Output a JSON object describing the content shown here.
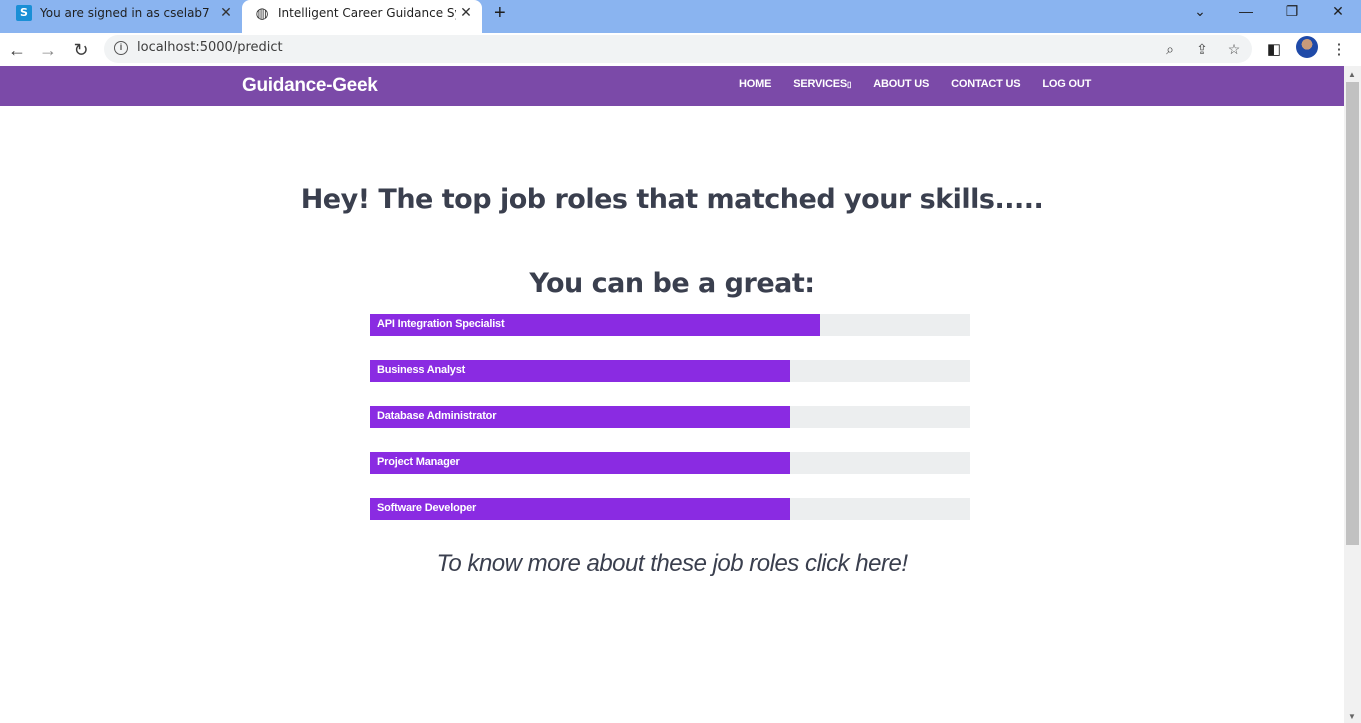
{
  "browser": {
    "tabs": [
      {
        "title": "You are signed in as cselab7",
        "icon": "s-logo-icon"
      },
      {
        "title": "Intelligent Career Guidance Syste",
        "icon": "globe-icon"
      }
    ],
    "url": "localhost:5000/predict"
  },
  "site": {
    "brand": "Guidance-Geek",
    "nav": [
      "HOME",
      "SERVICES",
      "ABOUT US",
      "CONTACT US",
      "LOG OUT"
    ],
    "services_caret": "▯"
  },
  "main": {
    "heading": "Hey! The top job roles that matched your skills.....",
    "subheading": "You can be a great:",
    "roles": [
      {
        "label": "API Integration Specialist",
        "progress": 0.75
      },
      {
        "label": "Business Analyst",
        "progress": 0.7
      },
      {
        "label": "Database Administrator",
        "progress": 0.7
      },
      {
        "label": "Project Manager",
        "progress": 0.7
      },
      {
        "label": "Software Developer",
        "progress": 0.7
      }
    ],
    "more_link": "To know more about these job roles click here!"
  },
  "colors": {
    "nav_bg": "#7b4aa8",
    "bar_fill": "#8a2be2",
    "bar_track": "#eceeef",
    "text": "#3a3f4e"
  }
}
